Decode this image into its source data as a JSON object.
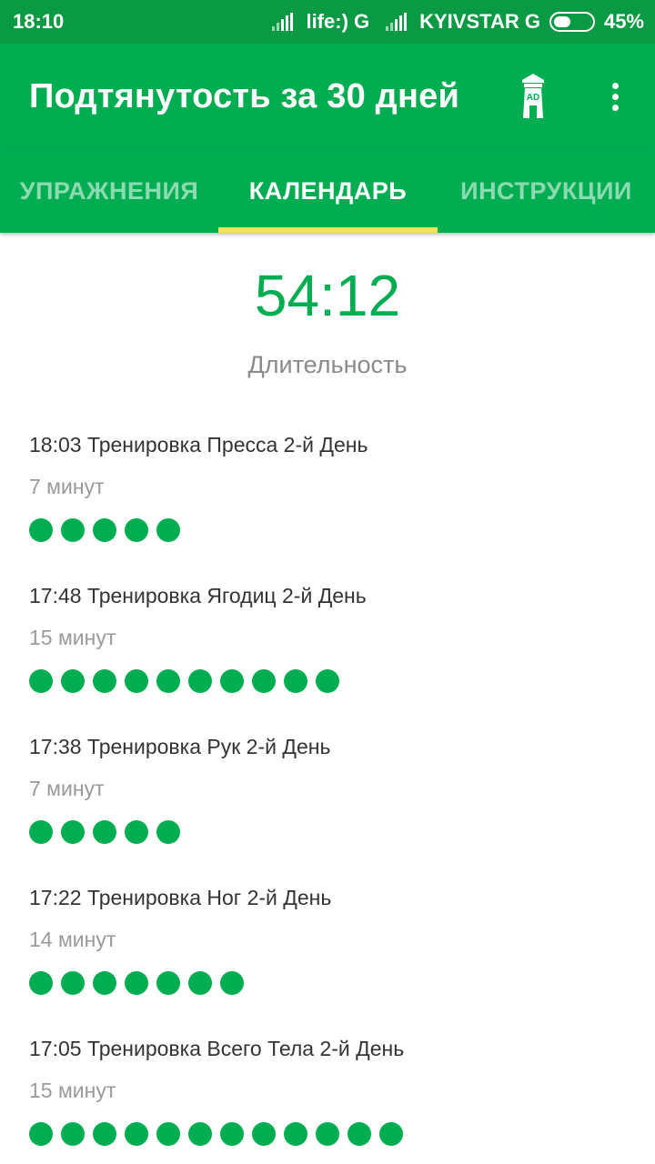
{
  "status_bar": {
    "time": "18:10",
    "carrier1": "life:) G",
    "carrier2": "KYIVSTAR G",
    "battery": "45%",
    "battery_level": 0.45
  },
  "app_bar": {
    "title": "Подтянутость за 30 дней",
    "ad_icon": "ad-tower-icon",
    "more_icon": "more-vert-icon"
  },
  "tabs": [
    {
      "label": "УПРАЖНЕНИЯ",
      "active": false
    },
    {
      "label": "КАЛЕНДАРЬ",
      "active": true
    },
    {
      "label": "ИНСТРУКЦИИ",
      "active": false
    }
  ],
  "summary": {
    "duration_value": "54:12",
    "duration_label": "Длительность"
  },
  "workouts": [
    {
      "title": "18:03 Тренировка Пресса 2-й День",
      "duration": "7 минут",
      "dots": 5
    },
    {
      "title": "17:48 Тренировка Ягодиц 2-й День",
      "duration": "15 минут",
      "dots": 10
    },
    {
      "title": "17:38 Тренировка Рук 2-й День",
      "duration": "7 минут",
      "dots": 5
    },
    {
      "title": "17:22 Тренировка Ног 2-й День",
      "duration": "14 минут",
      "dots": 7
    },
    {
      "title": "17:05 Тренировка Всего Тела 2-й День",
      "duration": "15 минут",
      "dots": 12
    }
  ],
  "colors": {
    "status_bar": "#0a9a43",
    "primary": "#00ad50",
    "tab_indicator": "#f5e15a",
    "secondary_text": "#9a9a9a"
  }
}
